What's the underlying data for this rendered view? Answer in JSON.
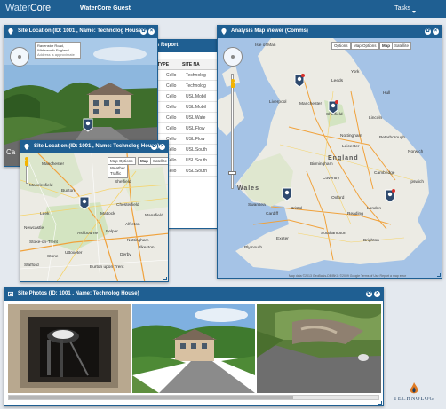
{
  "app": {
    "logo_prefix": "Water",
    "logo_suffix": "Core",
    "guest_label": "WaterCore Guest",
    "tasks_label": "Tasks"
  },
  "report_window": {
    "title": "ings Report",
    "columns": [
      "M",
      "TYPE",
      "SITE NA"
    ],
    "rows": [
      {
        "type": "Cello",
        "site": "Technolog"
      },
      {
        "type": "Cello",
        "site": "Technolog"
      },
      {
        "type": "Cello",
        "site": "USL Mobil"
      },
      {
        "type": "Cello",
        "site": "USL Mobil"
      },
      {
        "type": "Cello",
        "site": "USL Wate"
      },
      {
        "type": "Cello",
        "site": "USL Flow"
      },
      {
        "type": "Cello",
        "site": "USL Flow"
      },
      {
        "type": "Cello",
        "site": "USL South"
      },
      {
        "type": "Cello",
        "site": "USL South"
      },
      {
        "type": "Cello",
        "site": "USL South"
      }
    ]
  },
  "site_location_1": {
    "title": "Site Location (ID: 1001 , Name: Technolog House)",
    "address_line1": "Ravenstor Road, Wirksworth England",
    "address_line2": "Address is approximate",
    "bottom_text": "Ca"
  },
  "site_location_2": {
    "title": "Site Location (ID: 1001 , Name: Technolog House)",
    "controls": [
      "Map Options",
      "Map",
      "Satellite"
    ],
    "control_items": [
      "Weather",
      "Traffic"
    ],
    "places": [
      "Manchester",
      "Sheffield",
      "Chesterfield",
      "Buxton",
      "Macclesfield",
      "Stoke-on-Trent",
      "Derby",
      "Nottingham",
      "Burton upon Trent",
      "Leek",
      "Ashbourne",
      "Matlock",
      "Alfreton",
      "Mansfield",
      "Belper",
      "Stafford",
      "Stone",
      "Ilkeston",
      "Uttoxeter",
      "Newcastle"
    ]
  },
  "analysis_map": {
    "title": "Analysis Map Viewer (Comms)",
    "controls": [
      "Options",
      "Map Options",
      "Map",
      "Satellite"
    ],
    "places": [
      "Isle of Man",
      "Liverpool",
      "Manchester",
      "Leeds",
      "York",
      "Hull",
      "Sheffield",
      "Lincoln",
      "Nottingham",
      "Birmingham",
      "Norwich",
      "Cambridge",
      "Wales",
      "England",
      "Oxford",
      "Cardiff",
      "Bristol",
      "London",
      "Southampton",
      "Brighton",
      "Plymouth",
      "Exeter",
      "Leicester",
      "Peterborough",
      "Ipswich",
      "Coventry",
      "Swansea",
      "Reading"
    ],
    "footer": "Map data ©2013 GeoBasis-DE/BKG ©2009 Google  Terms of Use  Report a map error"
  },
  "site_photos": {
    "title": "Site Photos (ID: 1001 , Name: Technolog House)"
  },
  "branding": {
    "company": "TECHNOLOG"
  },
  "window_buttons": {
    "gear": "✿",
    "close": "×"
  }
}
